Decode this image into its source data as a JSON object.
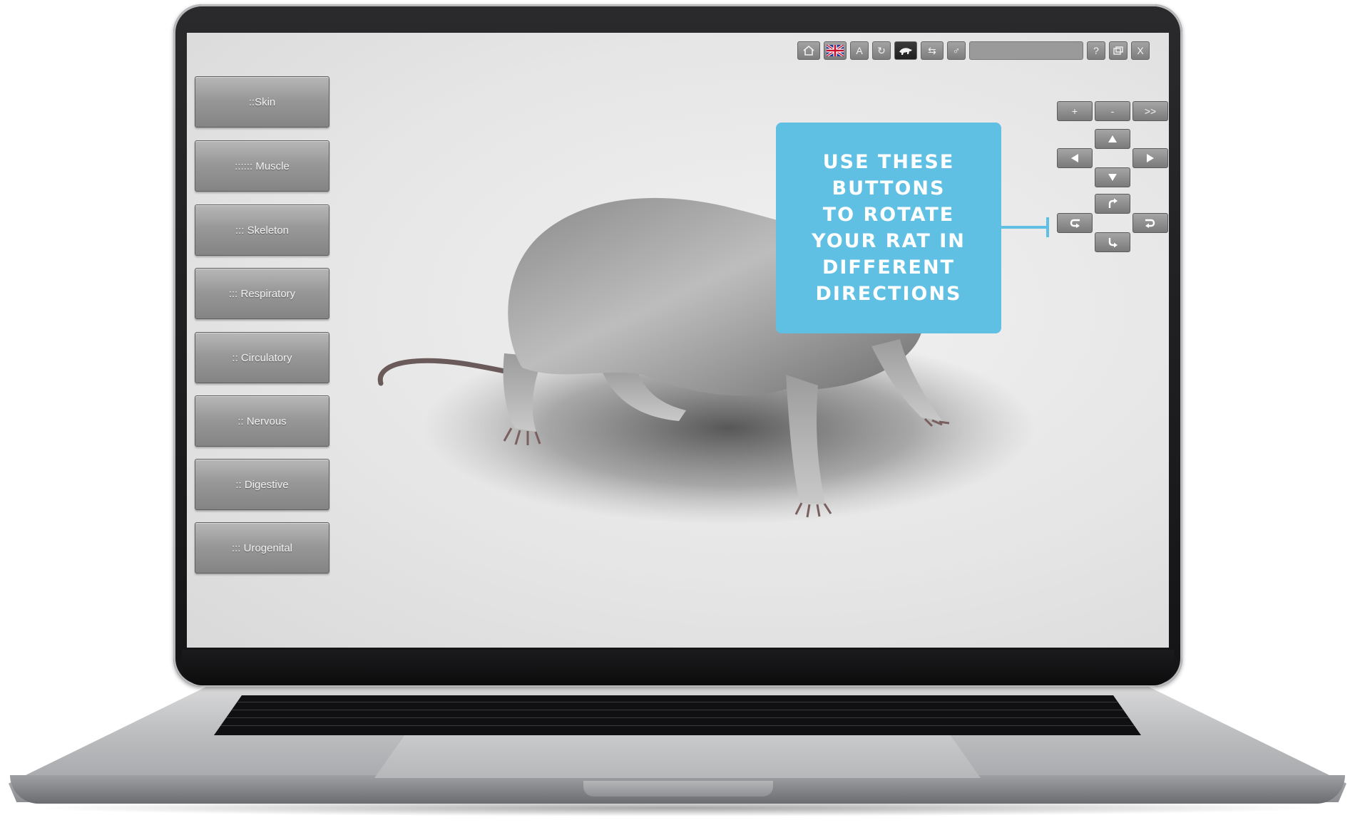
{
  "toolbar": {
    "items": [
      "home-icon",
      "uk-flag-icon",
      "text-a-icon",
      "refresh-icon",
      "rat-view-icon",
      "layers-icon",
      "male-symbol-icon",
      "search-field",
      "help-icon",
      "window-icon",
      "close-icon"
    ],
    "letter_a": "A",
    "help": "?",
    "close": "X"
  },
  "systems_menu": [
    {
      "label": "::Skin"
    },
    {
      "label": ":::::: Muscle"
    },
    {
      "label": "::: Skeleton"
    },
    {
      "label": "::: Respiratory"
    },
    {
      "label": ":: Circulatory"
    },
    {
      "label": ":: Nervous"
    },
    {
      "label": ":: Digestive"
    },
    {
      "label": "::: Urogenital"
    }
  ],
  "navigation": {
    "zoom_in": "+",
    "zoom_out": "-",
    "next": ">>",
    "icons": [
      "arrow-up-icon",
      "arrow-left-icon",
      "arrow-right-icon",
      "arrow-down-icon",
      "rotate-up-icon",
      "rotate-left-icon",
      "rotate-right-icon",
      "rotate-down-icon"
    ]
  },
  "callout": {
    "text": "USE THESE\nBUTTONS\nTO ROTATE\nYOUR RAT IN\nDIFFERENT\nDIRECTIONS"
  },
  "colors": {
    "callout": "#5fc0e3",
    "button_gray": "#8e8e8e",
    "screen_bg": "#e8e8e8"
  }
}
